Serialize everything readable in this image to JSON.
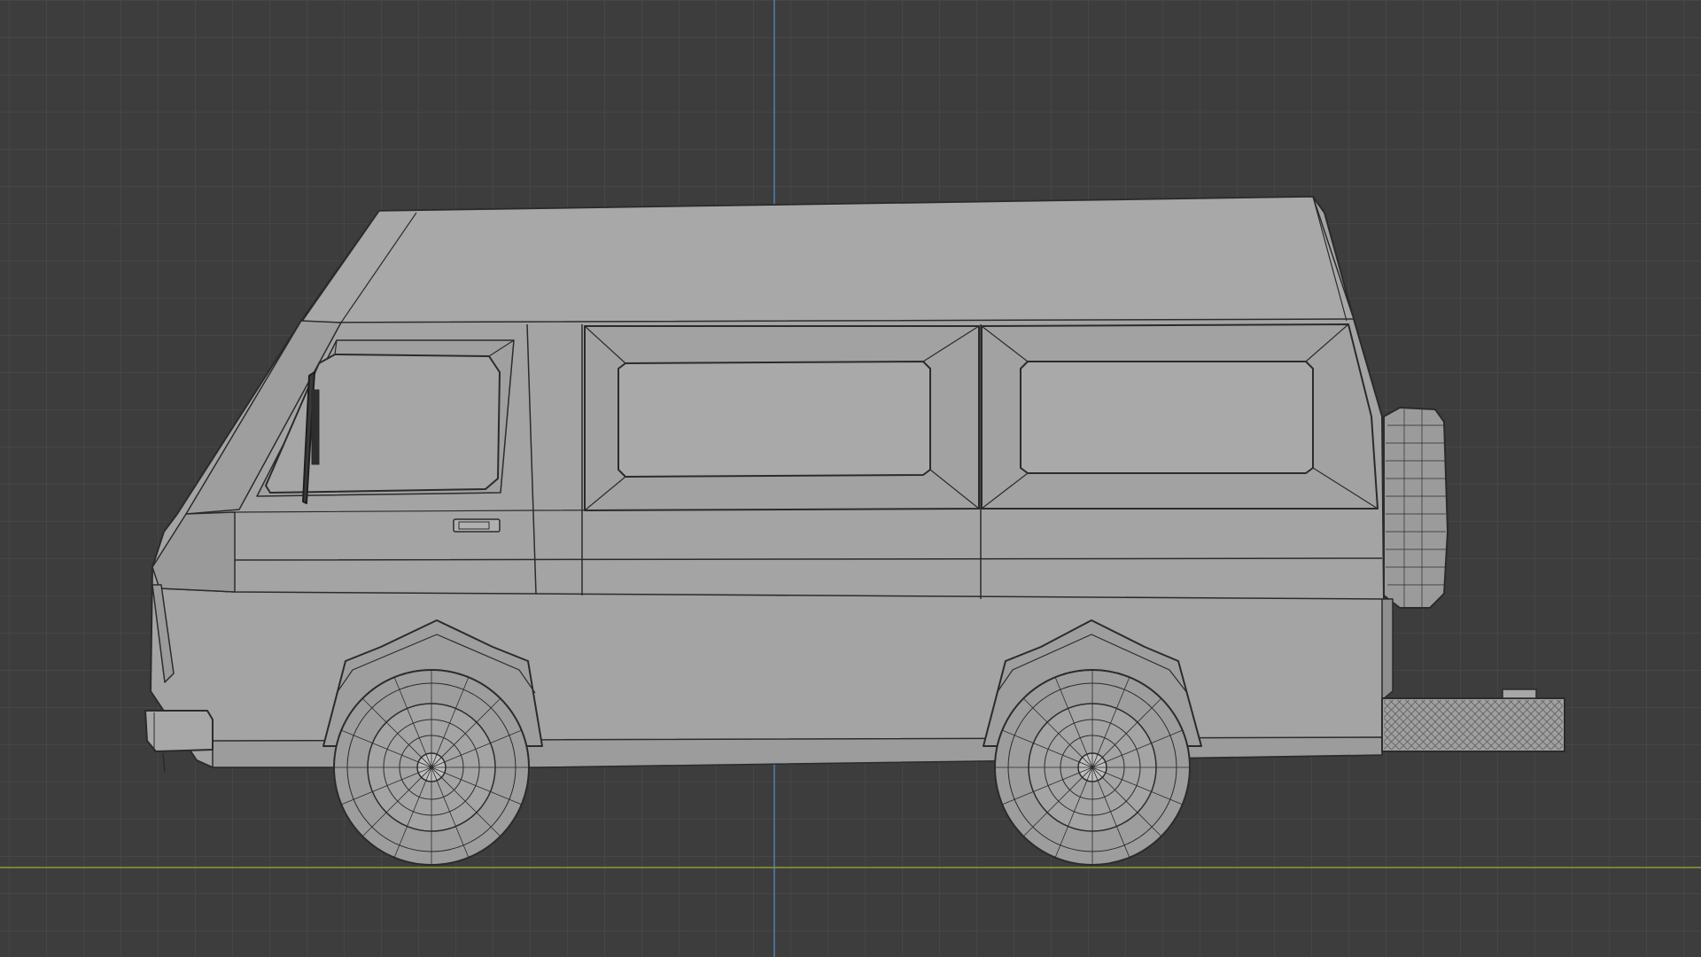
{
  "viewport": {
    "view": "right-orthographic",
    "mode": "wireframe-overlay",
    "colors": {
      "background": "#3d3d3d",
      "grid_line": "#4a4a4a",
      "axis_z": "#4f7fb3",
      "axis_y": "#8a9a3a",
      "mesh_fill": "#a4a4a4",
      "mesh_fill_dark": "#969696",
      "wire": "#2b2b2b"
    }
  },
  "model": {
    "name": "van",
    "parts": [
      "body",
      "roof",
      "windshield",
      "side-window-front",
      "side-window-rear",
      "door-handle",
      "wiper",
      "front-wheel",
      "rear-wheel",
      "spare-tire",
      "rear-step",
      "front-bumper"
    ]
  }
}
